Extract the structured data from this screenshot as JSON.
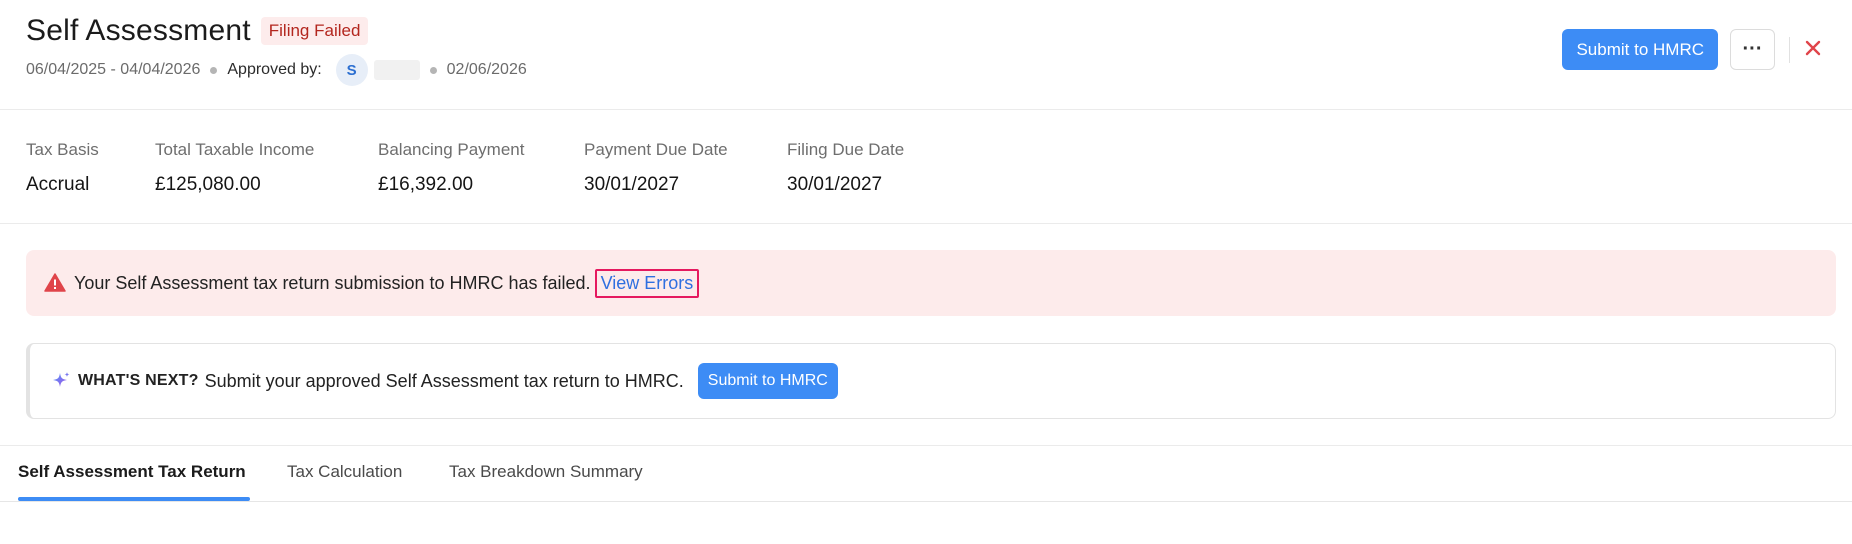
{
  "header": {
    "title": "Self Assessment",
    "status_badge": "Filing Failed",
    "period": "06/04/2025 - 04/04/2026",
    "approved_by_label": "Approved by:",
    "approver_initial": "S",
    "approved_date": "02/06/2026",
    "submit_button": "Submit to HMRC",
    "more_button": "···",
    "close_icon": "close-icon"
  },
  "summary": [
    {
      "label": "Tax Basis",
      "value": "Accrual"
    },
    {
      "label": "Total Taxable Income",
      "value": "£125,080.00"
    },
    {
      "label": "Balancing Payment",
      "value": "£16,392.00"
    },
    {
      "label": "Payment Due Date",
      "value": "30/01/2027"
    },
    {
      "label": "Filing Due Date",
      "value": "30/01/2027"
    }
  ],
  "alert": {
    "icon": "warning-icon",
    "message": "Your Self Assessment tax return submission to HMRC has failed.",
    "link": "View Errors"
  },
  "whats_next": {
    "icon": "sparkle-icon",
    "title": "WHAT'S NEXT?",
    "message": "Submit your approved Self Assessment tax return to HMRC.",
    "button": "Submit to HMRC"
  },
  "tabs": [
    {
      "label": "Self Assessment Tax Return",
      "active": true
    },
    {
      "label": "Tax Calculation",
      "active": false
    },
    {
      "label": "Tax Breakdown Summary",
      "active": false
    }
  ],
  "colors": {
    "primary": "#3d8cf5",
    "danger": "#e0444a",
    "alert_bg": "#fdebeb",
    "highlight_border": "#e5195f"
  }
}
